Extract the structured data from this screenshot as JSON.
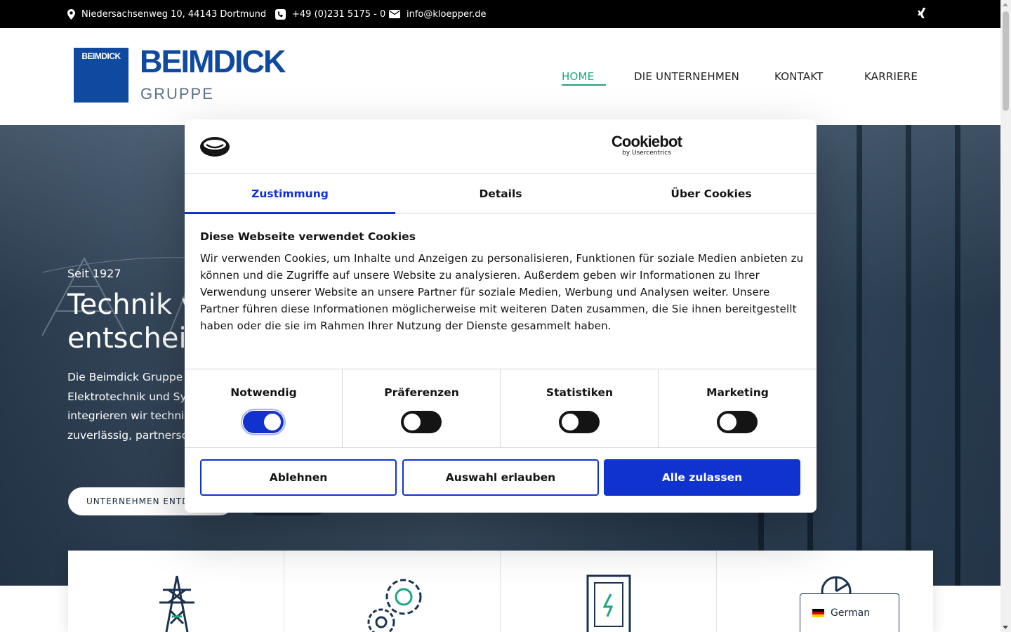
{
  "topbar": {
    "address": "Niedersachsenweg 10, 44143 Dortmund",
    "phone": "+49 (0)231 5175 - 0",
    "email": "info@kloepper.de",
    "social_icon": "xing-icon"
  },
  "header": {
    "logo_box_text": "BEIMDICK",
    "logo_name": "BEIMDICK",
    "logo_sub": "GRUPPE",
    "nav": [
      {
        "label": "HOME",
        "active": true
      },
      {
        "label": "DIE UNTERNEHMEN",
        "active": false
      },
      {
        "label": "KONTAKT",
        "active": false
      },
      {
        "label": "KARRIERE",
        "active": false
      }
    ],
    "accent_color": "#1aa67e"
  },
  "hero": {
    "kicker": "Seit 1927",
    "title": "Technik v… entscheid…",
    "title_line1": "Technik v",
    "title_line2": "entscheid",
    "lead_lines": [
      "Die Beimdick Gruppe v",
      "Elektrotechnik und Sys",
      "integrieren wir technis",
      "zuverlässig, partnersch"
    ],
    "button_primary": "UNTERNEHMEN ENTD"
  },
  "cards": {
    "icons": [
      "power-tower-icon",
      "gears-icon",
      "charging-station-icon",
      "chart-icon"
    ]
  },
  "cookie": {
    "brand_name": "Cookiebot",
    "brand_sub": "by Usercentrics",
    "tabs": [
      {
        "label": "Zustimmung",
        "active": true
      },
      {
        "label": "Details",
        "active": false
      },
      {
        "label": "Über Cookies",
        "active": false
      }
    ],
    "heading": "Diese Webseite verwendet Cookies",
    "text": "Wir verwenden Cookies, um Inhalte und Anzeigen zu personalisieren, Funktionen für soziale Medien anbieten zu können und die Zugriffe auf unsere Website zu analysieren. Außerdem geben wir Informationen zu Ihrer Verwendung unserer Website an unsere Partner für soziale Medien, Werbung und Analysen weiter. Unsere Partner führen diese Informationen möglicherweise mit weiteren Daten zusammen, die Sie ihnen bereitgestellt haben oder die sie im Rahmen Ihrer Nutzung der Dienste gesammelt haben.",
    "toggles": [
      {
        "label": "Notwendig",
        "on": true
      },
      {
        "label": "Präferenzen",
        "on": false
      },
      {
        "label": "Statistiken",
        "on": false
      },
      {
        "label": "Marketing",
        "on": false
      }
    ],
    "buttons": {
      "decline": "Ablehnen",
      "allow_selection": "Auswahl erlauben",
      "allow_all": "Alle zulassen"
    },
    "accent_color": "#1032cf"
  },
  "language": {
    "label": "German",
    "flag_colors": [
      "#000000",
      "#dd0000",
      "#ffce00"
    ]
  }
}
